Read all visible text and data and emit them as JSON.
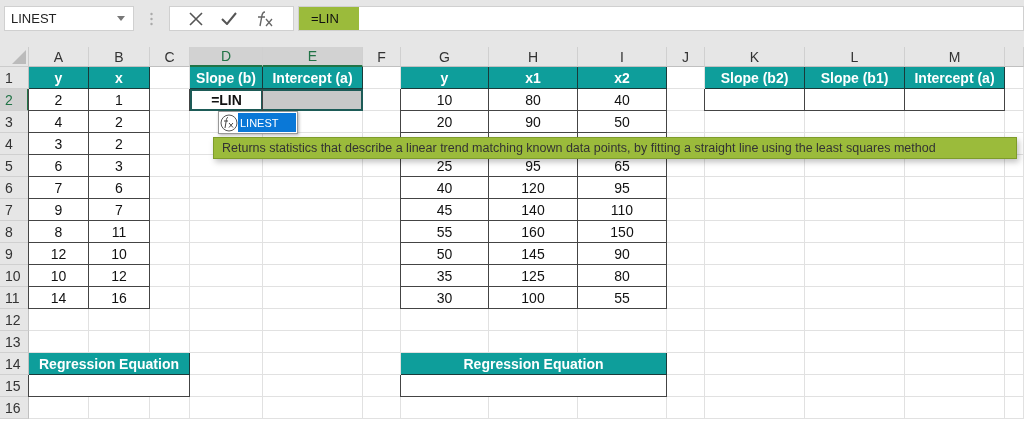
{
  "name_box": {
    "value": "LINEST"
  },
  "formula_bar": {
    "value": "=LIN"
  },
  "columns": [
    {
      "label": "A",
      "selected": false
    },
    {
      "label": "B",
      "selected": false
    },
    {
      "label": "C",
      "selected": false
    },
    {
      "label": "D",
      "selected": true
    },
    {
      "label": "E",
      "selected": true
    },
    {
      "label": "F",
      "selected": false
    },
    {
      "label": "G",
      "selected": false
    },
    {
      "label": "H",
      "selected": false
    },
    {
      "label": "I",
      "selected": false
    },
    {
      "label": "J",
      "selected": false
    },
    {
      "label": "K",
      "selected": false
    },
    {
      "label": "L",
      "selected": false
    },
    {
      "label": "M",
      "selected": false
    }
  ],
  "rows": [
    {
      "label": "1",
      "selected": false,
      "cells": [
        {
          "kind": "header",
          "text": "y"
        },
        {
          "kind": "header",
          "text": "x"
        },
        {
          "kind": "empty"
        },
        {
          "kind": "header",
          "text": "Slope (b)"
        },
        {
          "kind": "header",
          "text": "Intercept (a)"
        },
        {
          "kind": "empty"
        },
        {
          "kind": "header",
          "text": "y"
        },
        {
          "kind": "header",
          "text": "x1"
        },
        {
          "kind": "header",
          "text": "x2"
        },
        {
          "kind": "empty"
        },
        {
          "kind": "header",
          "text": "Slope (b2)"
        },
        {
          "kind": "header",
          "text": "Slope (b1)"
        },
        {
          "kind": "header",
          "text": "Intercept (a)"
        }
      ]
    },
    {
      "label": "2",
      "selected": true,
      "cells": [
        {
          "kind": "data",
          "text": "2"
        },
        {
          "kind": "data",
          "text": "1"
        },
        {
          "kind": "empty"
        },
        {
          "kind": "editing",
          "text": "=LIN"
        },
        {
          "kind": "range"
        },
        {
          "kind": "empty"
        },
        {
          "kind": "data",
          "text": "10"
        },
        {
          "kind": "data",
          "text": "80"
        },
        {
          "kind": "data",
          "text": "40"
        },
        {
          "kind": "empty"
        },
        {
          "kind": "blank"
        },
        {
          "kind": "blank"
        },
        {
          "kind": "blank"
        }
      ]
    },
    {
      "label": "3",
      "selected": false,
      "cells": [
        {
          "kind": "data",
          "text": "4"
        },
        {
          "kind": "data",
          "text": "2"
        },
        {
          "kind": "empty"
        },
        {
          "kind": "empty"
        },
        {
          "kind": "empty"
        },
        {
          "kind": "empty"
        },
        {
          "kind": "data",
          "text": "20"
        },
        {
          "kind": "data",
          "text": "90"
        },
        {
          "kind": "data",
          "text": "50"
        },
        {
          "kind": "empty"
        },
        {
          "kind": "empty"
        },
        {
          "kind": "empty"
        },
        {
          "kind": "empty"
        }
      ]
    },
    {
      "label": "4",
      "selected": false,
      "cells": [
        {
          "kind": "data",
          "text": "3"
        },
        {
          "kind": "data",
          "text": "2"
        },
        {
          "kind": "empty"
        },
        {
          "kind": "empty"
        },
        {
          "kind": "empty"
        },
        {
          "kind": "empty"
        },
        {
          "kind": "blank"
        },
        {
          "kind": "blank"
        },
        {
          "kind": "blank"
        },
        {
          "kind": "empty"
        },
        {
          "kind": "empty"
        },
        {
          "kind": "empty"
        },
        {
          "kind": "empty"
        }
      ]
    },
    {
      "label": "5",
      "selected": false,
      "cells": [
        {
          "kind": "data",
          "text": "6"
        },
        {
          "kind": "data",
          "text": "3"
        },
        {
          "kind": "empty"
        },
        {
          "kind": "empty"
        },
        {
          "kind": "empty"
        },
        {
          "kind": "empty"
        },
        {
          "kind": "data",
          "text": "25"
        },
        {
          "kind": "data",
          "text": "95"
        },
        {
          "kind": "data",
          "text": "65"
        },
        {
          "kind": "empty"
        },
        {
          "kind": "empty"
        },
        {
          "kind": "empty"
        },
        {
          "kind": "empty"
        }
      ]
    },
    {
      "label": "6",
      "selected": false,
      "cells": [
        {
          "kind": "data",
          "text": "7"
        },
        {
          "kind": "data",
          "text": "6"
        },
        {
          "kind": "empty"
        },
        {
          "kind": "empty"
        },
        {
          "kind": "empty"
        },
        {
          "kind": "empty"
        },
        {
          "kind": "data",
          "text": "40"
        },
        {
          "kind": "data",
          "text": "120"
        },
        {
          "kind": "data",
          "text": "95"
        },
        {
          "kind": "empty"
        },
        {
          "kind": "empty"
        },
        {
          "kind": "empty"
        },
        {
          "kind": "empty"
        }
      ]
    },
    {
      "label": "7",
      "selected": false,
      "cells": [
        {
          "kind": "data",
          "text": "9"
        },
        {
          "kind": "data",
          "text": "7"
        },
        {
          "kind": "empty"
        },
        {
          "kind": "empty"
        },
        {
          "kind": "empty"
        },
        {
          "kind": "empty"
        },
        {
          "kind": "data",
          "text": "45"
        },
        {
          "kind": "data",
          "text": "140"
        },
        {
          "kind": "data",
          "text": "110"
        },
        {
          "kind": "empty"
        },
        {
          "kind": "empty"
        },
        {
          "kind": "empty"
        },
        {
          "kind": "empty"
        }
      ]
    },
    {
      "label": "8",
      "selected": false,
      "cells": [
        {
          "kind": "data",
          "text": "8"
        },
        {
          "kind": "data",
          "text": "11"
        },
        {
          "kind": "empty"
        },
        {
          "kind": "empty"
        },
        {
          "kind": "empty"
        },
        {
          "kind": "empty"
        },
        {
          "kind": "data",
          "text": "55"
        },
        {
          "kind": "data",
          "text": "160"
        },
        {
          "kind": "data",
          "text": "150"
        },
        {
          "kind": "empty"
        },
        {
          "kind": "empty"
        },
        {
          "kind": "empty"
        },
        {
          "kind": "empty"
        }
      ]
    },
    {
      "label": "9",
      "selected": false,
      "cells": [
        {
          "kind": "data",
          "text": "12"
        },
        {
          "kind": "data",
          "text": "10"
        },
        {
          "kind": "empty"
        },
        {
          "kind": "empty"
        },
        {
          "kind": "empty"
        },
        {
          "kind": "empty"
        },
        {
          "kind": "data",
          "text": "50"
        },
        {
          "kind": "data",
          "text": "145"
        },
        {
          "kind": "data",
          "text": "90"
        },
        {
          "kind": "empty"
        },
        {
          "kind": "empty"
        },
        {
          "kind": "empty"
        },
        {
          "kind": "empty"
        }
      ]
    },
    {
      "label": "10",
      "selected": false,
      "cells": [
        {
          "kind": "data",
          "text": "10"
        },
        {
          "kind": "data",
          "text": "12"
        },
        {
          "kind": "empty"
        },
        {
          "kind": "empty"
        },
        {
          "kind": "empty"
        },
        {
          "kind": "empty"
        },
        {
          "kind": "data",
          "text": "35"
        },
        {
          "kind": "data",
          "text": "125"
        },
        {
          "kind": "data",
          "text": "80"
        },
        {
          "kind": "empty"
        },
        {
          "kind": "empty"
        },
        {
          "kind": "empty"
        },
        {
          "kind": "empty"
        }
      ]
    },
    {
      "label": "11",
      "selected": false,
      "cells": [
        {
          "kind": "data",
          "text": "14"
        },
        {
          "kind": "data",
          "text": "16"
        },
        {
          "kind": "empty"
        },
        {
          "kind": "empty"
        },
        {
          "kind": "empty"
        },
        {
          "kind": "empty"
        },
        {
          "kind": "data",
          "text": "30"
        },
        {
          "kind": "data",
          "text": "100"
        },
        {
          "kind": "data",
          "text": "55"
        },
        {
          "kind": "empty"
        },
        {
          "kind": "empty"
        },
        {
          "kind": "empty"
        },
        {
          "kind": "empty"
        }
      ]
    },
    {
      "label": "12",
      "selected": false,
      "cells": [
        {
          "kind": "empty"
        },
        {
          "kind": "empty"
        },
        {
          "kind": "empty"
        },
        {
          "kind": "empty"
        },
        {
          "kind": "empty"
        },
        {
          "kind": "empty"
        },
        {
          "kind": "empty"
        },
        {
          "kind": "empty"
        },
        {
          "kind": "empty"
        },
        {
          "kind": "empty"
        },
        {
          "kind": "empty"
        },
        {
          "kind": "empty"
        },
        {
          "kind": "empty"
        }
      ]
    },
    {
      "label": "13",
      "selected": false,
      "cells": [
        {
          "kind": "empty"
        },
        {
          "kind": "empty"
        },
        {
          "kind": "empty"
        },
        {
          "kind": "empty"
        },
        {
          "kind": "empty"
        },
        {
          "kind": "empty"
        },
        {
          "kind": "empty"
        },
        {
          "kind": "empty"
        },
        {
          "kind": "empty"
        },
        {
          "kind": "empty"
        },
        {
          "kind": "empty"
        },
        {
          "kind": "empty"
        },
        {
          "kind": "empty"
        }
      ]
    },
    {
      "label": "14",
      "selected": false,
      "cells": [
        {
          "kind": "header-wide",
          "text": "Regression Equation"
        },
        {
          "kind": "empty"
        },
        {
          "kind": "empty"
        },
        {
          "kind": "empty"
        },
        {
          "kind": "header-wide",
          "text": "Regression Equation"
        },
        {
          "kind": "empty"
        },
        {
          "kind": "empty"
        },
        {
          "kind": "empty"
        },
        {
          "kind": "empty"
        }
      ]
    },
    {
      "label": "15",
      "selected": false,
      "cells": [
        {
          "kind": "blank-wide"
        },
        {
          "kind": "empty"
        },
        {
          "kind": "empty"
        },
        {
          "kind": "empty"
        },
        {
          "kind": "blank-wide"
        },
        {
          "kind": "empty"
        },
        {
          "kind": "empty"
        },
        {
          "kind": "empty"
        },
        {
          "kind": "empty"
        }
      ]
    },
    {
      "label": "16",
      "selected": false,
      "cells": [
        {
          "kind": "empty"
        },
        {
          "kind": "empty"
        },
        {
          "kind": "empty"
        },
        {
          "kind": "empty"
        },
        {
          "kind": "empty"
        },
        {
          "kind": "empty"
        },
        {
          "kind": "empty"
        },
        {
          "kind": "empty"
        },
        {
          "kind": "empty"
        },
        {
          "kind": "empty"
        },
        {
          "kind": "empty"
        },
        {
          "kind": "empty"
        },
        {
          "kind": "empty"
        }
      ]
    }
  ],
  "autocomplete": {
    "items": [
      {
        "label": "LINEST",
        "selected": true
      }
    ]
  },
  "tooltip": {
    "text": "Returns statistics that describe a linear trend matching known data points, by fitting a straight line using the least squares method"
  }
}
